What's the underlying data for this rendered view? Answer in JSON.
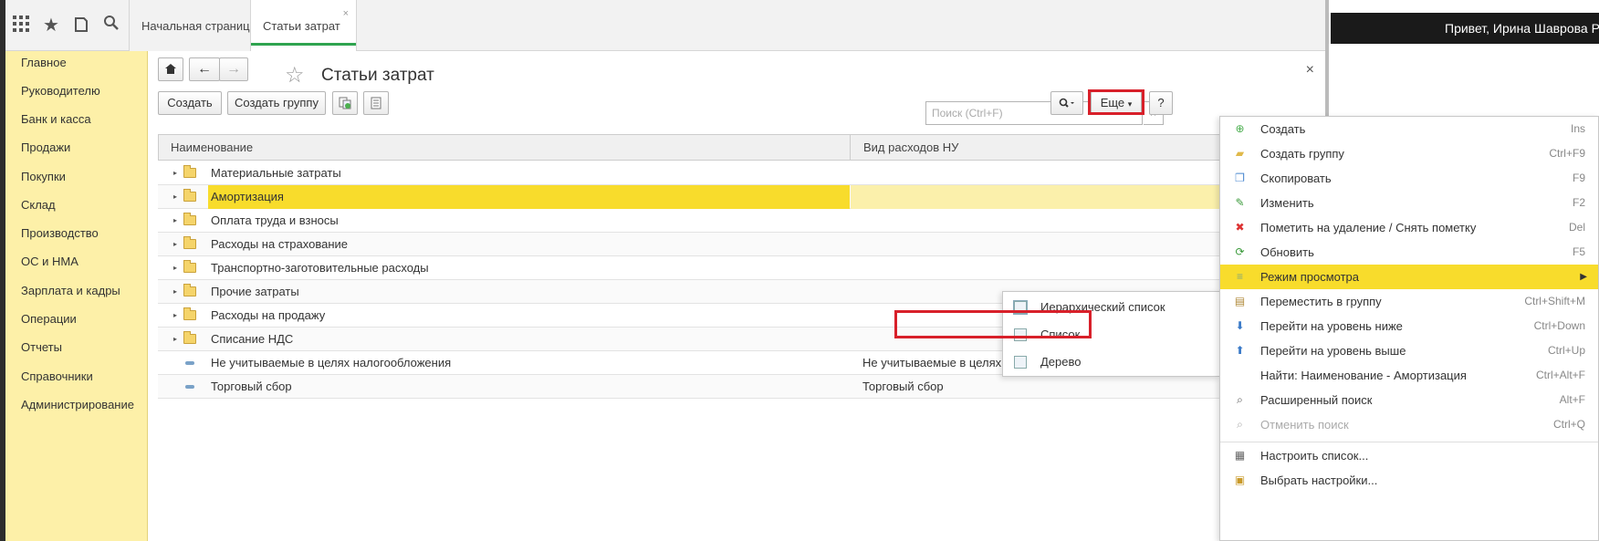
{
  "tabs": [
    {
      "label": "Начальная страница"
    },
    {
      "label": "Статьи затрат",
      "close": "×"
    }
  ],
  "header": {
    "greeting": "Привет, Ирина Шаврова Р"
  },
  "sidebar": {
    "items": [
      {
        "label": "Главное"
      },
      {
        "label": "Руководителю"
      },
      {
        "label": "Банк и касса"
      },
      {
        "label": "Продажи"
      },
      {
        "label": "Покупки"
      },
      {
        "label": "Склад"
      },
      {
        "label": "Производство"
      },
      {
        "label": "ОС и НМА"
      },
      {
        "label": "Зарплата и кадры"
      },
      {
        "label": "Операции"
      },
      {
        "label": "Отчеты"
      },
      {
        "label": "Справочники"
      },
      {
        "label": "Администрирование"
      }
    ]
  },
  "form": {
    "title": "Статьи затрат",
    "close": "×",
    "toolbar": {
      "create": "Создать",
      "create_group": "Создать группу",
      "more": "Еще",
      "help": "?"
    },
    "search": {
      "placeholder": "Поиск (Ctrl+F)",
      "clear": "×"
    }
  },
  "table": {
    "columns": [
      "Наименование",
      "Вид расходов НУ"
    ],
    "rows": [
      {
        "name": "Материальные затраты",
        "type": "",
        "kind": "folder"
      },
      {
        "name": "Амортизация",
        "type": "",
        "kind": "folder",
        "selected": true
      },
      {
        "name": "Оплата труда и взносы",
        "type": "",
        "kind": "folder"
      },
      {
        "name": "Расходы на страхование",
        "type": "",
        "kind": "folder"
      },
      {
        "name": "Транспортно-заготовительные расходы",
        "type": "",
        "kind": "folder"
      },
      {
        "name": "Прочие затраты",
        "type": "",
        "kind": "folder"
      },
      {
        "name": "Расходы на продажу",
        "type": "",
        "kind": "folder"
      },
      {
        "name": "Списание НДС",
        "type": "",
        "kind": "folder"
      },
      {
        "name": "Не учитываемые в целях налогообложения",
        "type": "Не учитываемые в целях налогообложения",
        "kind": "item"
      },
      {
        "name": "Торговый сбор",
        "type": "Торговый сбор",
        "kind": "item"
      }
    ]
  },
  "menu": {
    "items": [
      {
        "label": "Создать",
        "shortcut": "Ins",
        "icon": "plus-icon"
      },
      {
        "label": "Создать группу",
        "shortcut": "Ctrl+F9",
        "icon": "folder-plus-icon"
      },
      {
        "label": "Скопировать",
        "shortcut": "F9",
        "icon": "copy-icon"
      },
      {
        "label": "Изменить",
        "shortcut": "F2",
        "icon": "pencil-icon"
      },
      {
        "label": "Пометить на удаление / Снять пометку",
        "shortcut": "Del",
        "icon": "delete-mark-icon"
      },
      {
        "label": "Обновить",
        "shortcut": "F5",
        "icon": "refresh-icon"
      },
      {
        "label": "Режим просмотра",
        "shortcut": "",
        "icon": "view-mode-icon",
        "submenu": true,
        "highlighted": true
      },
      {
        "label": "Переместить в группу",
        "shortcut": "Ctrl+Shift+M",
        "icon": "move-icon"
      },
      {
        "label": "Перейти на уровень ниже",
        "shortcut": "Ctrl+Down",
        "icon": "level-down-icon"
      },
      {
        "label": "Перейти на уровень выше",
        "shortcut": "Ctrl+Up",
        "icon": "level-up-icon"
      },
      {
        "label": "Найти: Наименование - Амортизация",
        "shortcut": "Ctrl+Alt+F",
        "icon": ""
      },
      {
        "label": "Расширенный поиск",
        "shortcut": "Alt+F",
        "icon": "search-icon"
      },
      {
        "label": "Отменить поиск",
        "shortcut": "Ctrl+Q",
        "icon": "cancel-search-icon",
        "disabled": true
      },
      {
        "label": "Настроить список...",
        "shortcut": "",
        "icon": "settings-list-icon"
      },
      {
        "label": "Выбрать настройки...",
        "shortcut": "",
        "icon": "choose-settings-icon"
      }
    ]
  },
  "submenu": {
    "items": [
      {
        "label": "Иерархический список",
        "checked": true
      },
      {
        "label": "Список"
      },
      {
        "label": "Дерево"
      }
    ]
  },
  "colors": {
    "accent_yellow": "#f8dc2c",
    "sidebar_bg": "#fdf0a8",
    "highlight_red": "#d8202a",
    "tab_green": "#2fa44f"
  }
}
